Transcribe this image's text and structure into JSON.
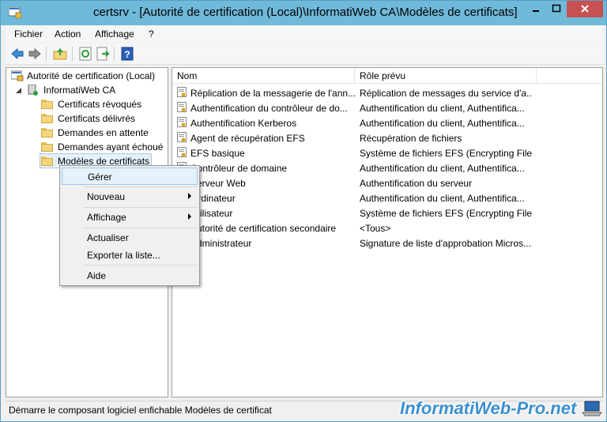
{
  "window": {
    "title": "certsrv - [Autorité de certification (Local)\\InformatiWeb CA\\Modèles de certificats]"
  },
  "menu": [
    "Fichier",
    "Action",
    "Affichage",
    "?"
  ],
  "toolbar": {
    "icons": [
      "back-arrow-icon",
      "forward-arrow-icon",
      "up-folder-icon",
      "refresh-icon",
      "export-list-icon",
      "help-icon"
    ]
  },
  "tree": {
    "root": "Autorité de certification (Local)",
    "ca": "InformatiWeb CA",
    "folders": [
      "Certificats révoqués",
      "Certificats délivrés",
      "Demandes en attente",
      "Demandes ayant échoué",
      "Modèles de certificats"
    ]
  },
  "list": {
    "headers": [
      "Nom",
      "Rôle prévu"
    ],
    "rows": [
      {
        "name": "Réplication de la messagerie de l'ann...",
        "role": "Réplication de messages du service d'a..."
      },
      {
        "name": "Authentification du contrôleur de do...",
        "role": "Authentification du client, Authentifica..."
      },
      {
        "name": "Authentification Kerberos",
        "role": "Authentification du client, Authentifica..."
      },
      {
        "name": "Agent de récupération EFS",
        "role": "Récupération de fichiers"
      },
      {
        "name": "EFS basique",
        "role": "Système de fichiers EFS (Encrypting File..."
      },
      {
        "name": "Contrôleur de domaine",
        "role": "Authentification du client, Authentifica..."
      },
      {
        "name": "Serveur Web",
        "role": "Authentification du serveur"
      },
      {
        "name": "Ordinateur",
        "role": "Authentification du client, Authentifica..."
      },
      {
        "name": "Utilisateur",
        "role": "Système de fichiers EFS (Encrypting File..."
      },
      {
        "name": "Autorité de certification secondaire",
        "role": "<Tous>"
      },
      {
        "name": "Administrateur",
        "role": "Signature de liste d'approbation Micros..."
      }
    ]
  },
  "context_menu": {
    "items": [
      "Gérer",
      "Nouveau",
      "Affichage",
      "Actualiser",
      "Exporter la liste...",
      "Aide"
    ]
  },
  "status": {
    "text": "Démarre le composant logiciel enfichable Modèles de certificat"
  },
  "watermark": {
    "text": "InformatiWeb-Pro.net"
  },
  "colors": {
    "titlebar": "#6fb9d9",
    "close": "#c75050",
    "highlight": "#e5f1fb"
  }
}
